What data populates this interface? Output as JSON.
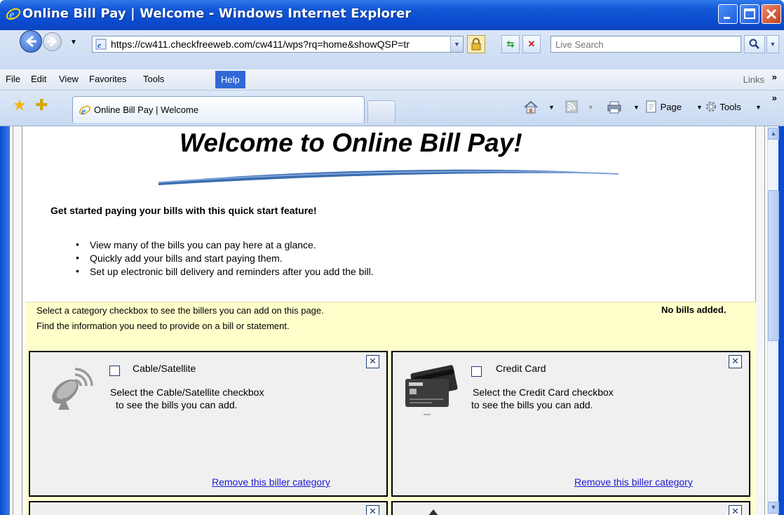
{
  "window": {
    "title": "Online Bill Pay | Welcome - Windows Internet Explorer"
  },
  "navbar": {
    "url": "https://cw411.checkfreeweb.com/cw411/wps?rq=home&showQSP=tr",
    "search_placeholder": "Live Search"
  },
  "menu": {
    "items": [
      "File",
      "Edit",
      "View",
      "Favorites",
      "Tools",
      "Help"
    ],
    "links_label": "Links"
  },
  "tabs": {
    "active_label": "Online Bill Pay | Welcome",
    "page_label": "Page",
    "tools_label": "Tools"
  },
  "page": {
    "heading": "Welcome to Online Bill Pay!",
    "intro": "Get started paying your bills with this quick start feature!",
    "bullets": [
      "View many of the bills you can pay here at a glance.",
      "Quickly add your bills and start paying them.",
      "Set up electronic bill delivery and reminders after you add the bill."
    ],
    "hint_line1": "Select a category checkbox to see the billers you can add on this page.",
    "hint_line2": "Find the information you need to provide on a bill or statement.",
    "status": "No bills added."
  },
  "categories": [
    {
      "title": "Cable/Satellite",
      "desc_line1": "Select the Cable/Satellite checkbox",
      "desc_line2": "to see the bills you can add.",
      "remove_label": "Remove this biller category",
      "close_glyph": "✕"
    },
    {
      "title": "Credit Card",
      "desc_line1": "Select the Credit Card checkbox",
      "desc_line2": "to see the bills you can add.",
      "remove_label": "Remove this biller category",
      "close_glyph": "✕"
    }
  ],
  "colors": {
    "titlebar_blue": "#0a4bd0",
    "category_panel_bg": "#ffffcc",
    "link_blue": "#1a1ad0",
    "swoosh_blue": "#3a6db0"
  }
}
